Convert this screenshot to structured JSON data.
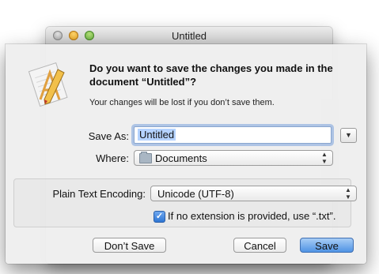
{
  "window": {
    "title": "Untitled"
  },
  "alert": {
    "message": "Do you want to save the changes you made in the document “Untitled”?",
    "informative": "Your changes will be lost if you don’t save them."
  },
  "save_as": {
    "label": "Save As:",
    "value": "Untitled"
  },
  "where": {
    "label": "Where:",
    "value": "Documents",
    "icon": "folder-icon"
  },
  "encoding": {
    "label": "Plain Text Encoding:",
    "value": "Unicode (UTF-8)"
  },
  "extension_checkbox": {
    "label": "If no extension is provided, use “.txt”.",
    "checked": true
  },
  "buttons": {
    "dont_save": "Don’t Save",
    "cancel": "Cancel",
    "save": "Save"
  },
  "colors": {
    "accent": "#4f93e4",
    "selection": "#b5d3ff"
  }
}
